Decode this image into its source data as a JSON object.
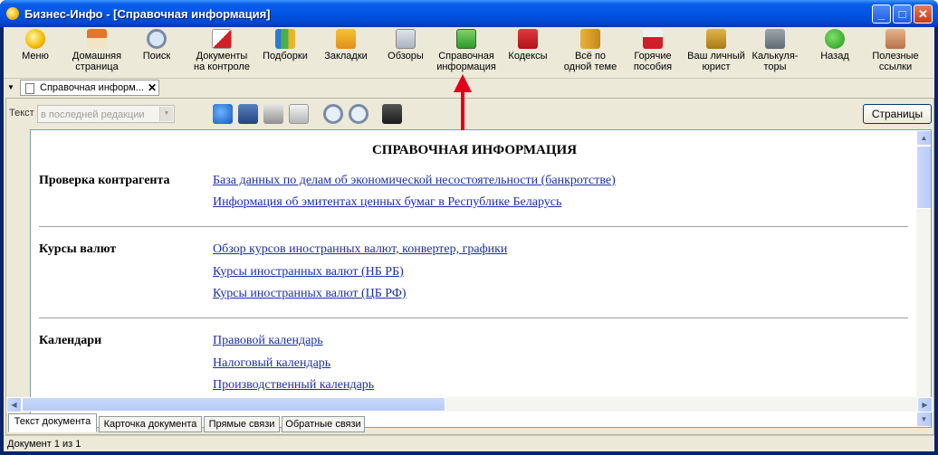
{
  "window": {
    "title": "Бизнес-Инфо - [Справочная информация]"
  },
  "toolbar": {
    "items": [
      {
        "label": "Меню",
        "icon": "menu-icon"
      },
      {
        "label": "Домашняя\nстраница",
        "icon": "home-icon"
      },
      {
        "label": "Поиск",
        "icon": "search-icon"
      },
      {
        "label": "Документы\nна контроле",
        "icon": "checklist-icon"
      },
      {
        "label": "Подборки",
        "icon": "binders-icon"
      },
      {
        "label": "Закладки",
        "icon": "bookmarks-icon"
      },
      {
        "label": "Обзоры",
        "icon": "reviews-icon"
      },
      {
        "label": "Справочная\nинформация",
        "icon": "reference-chart-icon"
      },
      {
        "label": "Кодексы",
        "icon": "codes-icon"
      },
      {
        "label": "Всё по\nодной теме",
        "icon": "topic-icon"
      },
      {
        "label": "Горячие\nпособия",
        "icon": "hot-guides-icon"
      },
      {
        "label": "Ваш личный\nюрист",
        "icon": "scales-icon"
      },
      {
        "label": "Калькуля-\nторы",
        "icon": "calculator-icon"
      },
      {
        "label": "Назад",
        "icon": "back-arrow-icon"
      },
      {
        "label": "Полезные\nссылки",
        "icon": "useful-links-icon"
      }
    ]
  },
  "doc_tab": {
    "label": "Справочная информ...",
    "close": "✕"
  },
  "panel_toolbar": {
    "text_label": "Текст",
    "edition_select": "в последней редакции",
    "pages_button": "Страницы"
  },
  "document": {
    "title": "СПРАВОЧНАЯ ИНФОРМАЦИЯ",
    "sections": [
      {
        "label": "Проверка контрагента",
        "links": [
          "База данных по делам об экономической несостоятельности (банкротстве)",
          "Информация об эмитентах ценных бумаг в Республике Беларусь"
        ]
      },
      {
        "label": "Курсы валют",
        "links": [
          "Обзор курсов иностранных валют, конвертер, графики",
          "Курсы иностранных валют (НБ РБ)",
          "Курсы иностранных валют (ЦБ РФ)"
        ]
      },
      {
        "label": "Календари",
        "links": [
          "Правовой календарь",
          "Налоговый календарь",
          "Производственный календарь"
        ]
      }
    ]
  },
  "bottom_tabs": [
    "Текст документа",
    "Карточка документа",
    "Прямые связи",
    "Обратные связи"
  ],
  "status": {
    "text": "Документ 1 из 1"
  },
  "colors": {
    "link": "#1b2fa6",
    "titlebar": "#0055e5",
    "annotation_arrow": "#e2001a"
  }
}
